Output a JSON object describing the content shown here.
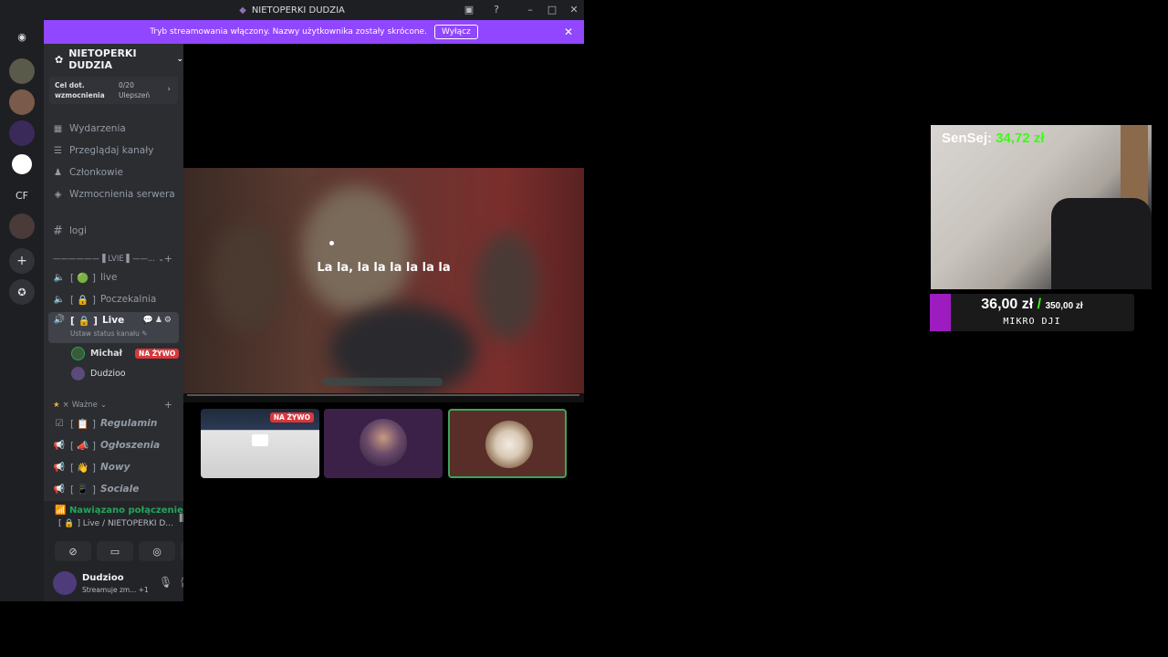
{
  "window": {
    "title": "NIETOPERKI DUDZIA"
  },
  "banner": {
    "text": "Tryb streamowania włączony. Nazwy użytkownika zostały skrócone.",
    "button": "Wyłącz"
  },
  "rail": {
    "cf_label": "CF"
  },
  "server": {
    "name": "NIETOPERKI DUDZIA",
    "boost_goal_label": "Cel dot. wzmocnienia",
    "boost_count": "0/20",
    "boost_unit": "Ulepszeń",
    "nav": [
      {
        "label": "Wydarzenia",
        "icon": "calendar-icon"
      },
      {
        "label": "Przeglądaj kanały",
        "icon": "browse-icon"
      },
      {
        "label": "Członkowie",
        "icon": "members-icon"
      },
      {
        "label": "Wzmocnienia serwera",
        "icon": "boost-icon"
      }
    ],
    "text_channel": "logi"
  },
  "categories": {
    "live": "——————▐ LVIE ▌——...",
    "important": "Ważne"
  },
  "voice_channels": [
    {
      "label": "live",
      "prefix": "[ 🟢 ]"
    },
    {
      "label": "Poczekalnia",
      "prefix": "[ 🔒 ]"
    },
    {
      "label": "Live",
      "prefix": "[ 🔒 ]",
      "sub": "Ustaw status kanału ✎"
    }
  ],
  "members": [
    {
      "name": "Michał",
      "badge": "NA ŻYWO"
    },
    {
      "name": "Dudzioo"
    }
  ],
  "important_channels": [
    {
      "label": "Regulamin",
      "prefix": "[ 📋 ]"
    },
    {
      "label": "Ogłoszenia",
      "prefix": "[ 📣 ]"
    },
    {
      "label": "Nowy",
      "prefix": "[ 👋 ]"
    },
    {
      "label": "Sociale",
      "prefix": "[ 📱 ]"
    }
  ],
  "voice_bar": {
    "status": "Nawiązano połączenie",
    "channel": "[ 🔒 ]  Live / NIETOPERKI D..."
  },
  "user": {
    "name": "Dudzioo",
    "status": "Streamuje zm...",
    "extra": "+1"
  },
  "stream": {
    "subtitle": "La la, la la la la la la",
    "tile_badge": "NA ŻYWO"
  },
  "overlay": {
    "donor_label": "SenSej:",
    "donor_amount": "34,72 zł",
    "goal_current": "36,00 zł",
    "goal_separator": "/",
    "goal_target": "350,00 zł",
    "goal_name": "MIKRO DJI",
    "goal_progress_fraction": 0.103
  },
  "colors": {
    "accent": "#9146ff",
    "live_red": "#da373c",
    "online_green": "#23a55a",
    "donation_green": "#39ff14",
    "goal_purple": "#9c1cc0"
  }
}
